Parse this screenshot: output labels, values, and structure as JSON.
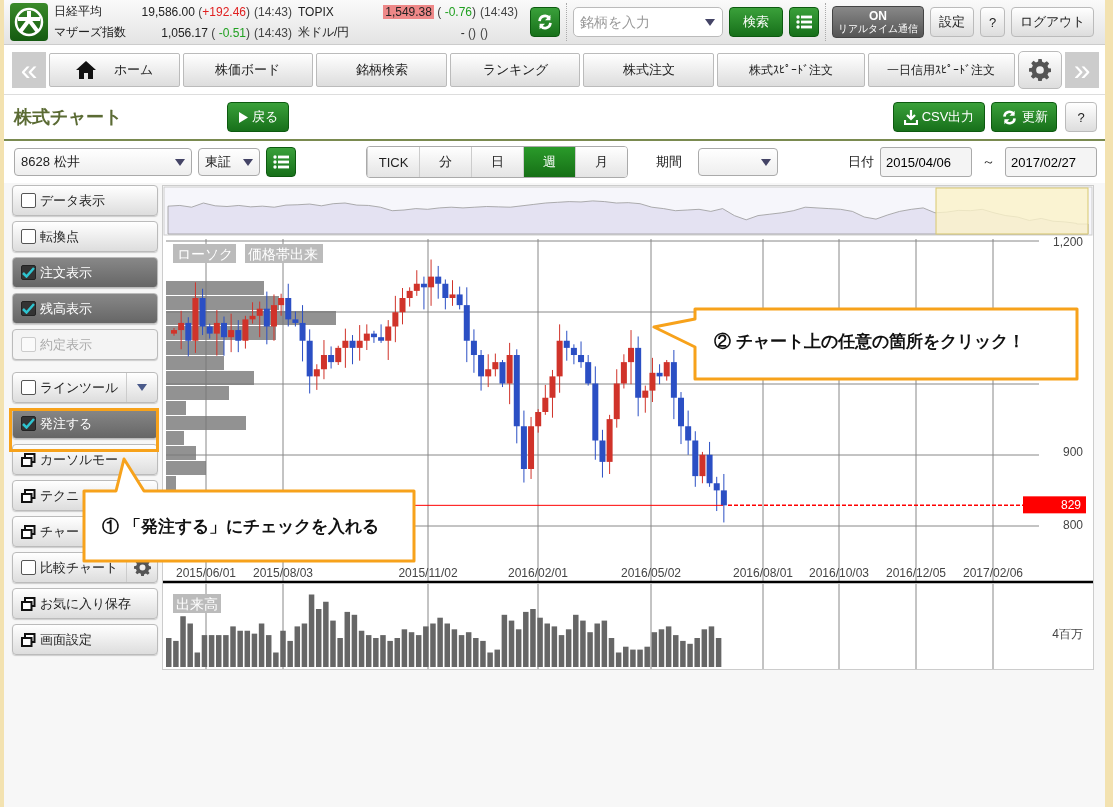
{
  "header": {
    "indices": [
      {
        "name": "日経平均",
        "value": "19,586.00",
        "change": "(+192.46)",
        "color": "#e02020",
        "time": "(14:43)",
        "highlighted": false
      },
      {
        "name": "マザーズ指数",
        "value": "1,056.17",
        "change": "( -0.51)",
        "color": "#20a020",
        "time": "(14:43)",
        "highlighted": false
      },
      {
        "name": "TOPIX",
        "value": "1,549.38",
        "change": "( -0.76)",
        "color": "#20a020",
        "time": "(14:43)",
        "highlighted": true
      },
      {
        "name": "米ドル/円",
        "value": "-",
        "change": "()",
        "color": "#444444",
        "time": "()",
        "highlighted": false
      }
    ],
    "search": {
      "placeholder": "銘柄を入力"
    },
    "search_button": "検索",
    "realtime": {
      "state": "ON",
      "label": "リアルタイム通信",
      "on": true
    },
    "buttons": [
      "設定",
      "?",
      "ログアウト"
    ]
  },
  "nav": {
    "tabs": [
      {
        "label": "ホーム"
      },
      {
        "label": "株価ボード"
      },
      {
        "label": "銘柄検索"
      },
      {
        "label": "ランキング"
      },
      {
        "label": "株式注文"
      },
      {
        "label": "株式ｽﾋﾟｰﾄﾞ注文"
      },
      {
        "label": "一日信用ｽﾋﾟｰﾄﾞ注文"
      }
    ],
    "prev": "«",
    "next": "»"
  },
  "page": {
    "title": "株式チャート",
    "back_button": "戻る",
    "csv_button": "CSV出力",
    "refresh_button": "更新",
    "help_button": "?"
  },
  "controls": {
    "symbol": "8628 松井",
    "market": "東証",
    "intervals": [
      {
        "label": "TICK",
        "selected": false
      },
      {
        "label": "分",
        "selected": false
      },
      {
        "label": "日",
        "selected": false
      },
      {
        "label": "週",
        "selected": true
      },
      {
        "label": "月",
        "selected": false
      }
    ],
    "period_label": "期間",
    "date_label": "日付",
    "date_from": "2015/04/06",
    "separator": "～",
    "date_to": "2017/02/27"
  },
  "sidebar": {
    "groups": [
      [
        {
          "kind": "checkbox",
          "label": "データ表示",
          "checked": false,
          "disabled": false
        },
        {
          "kind": "checkbox",
          "label": "転換点",
          "checked": false,
          "disabled": false
        },
        {
          "kind": "checkbox",
          "label": "注文表示",
          "checked": true,
          "disabled": false
        },
        {
          "kind": "checkbox",
          "label": "残高表示",
          "checked": true,
          "disabled": false
        },
        {
          "kind": "checkbox",
          "label": "約定表示",
          "checked": false,
          "disabled": true
        }
      ],
      [
        {
          "kind": "checkbox-dropdown",
          "label": "ラインツール",
          "checked": false,
          "disabled": false
        },
        {
          "kind": "checkbox",
          "label": "発注する",
          "checked": true,
          "disabled": false
        },
        {
          "kind": "window",
          "label": "カーソルモー"
        },
        {
          "kind": "window",
          "label": "テクニ"
        },
        {
          "kind": "window",
          "label": "チャー"
        },
        {
          "kind": "checkbox-gear",
          "label": "比較チャート",
          "checked": false,
          "disabled": false
        },
        {
          "kind": "window",
          "label": "お気に入り保存"
        },
        {
          "kind": "window",
          "label": "画面設定"
        }
      ]
    ]
  },
  "chart": {
    "candle_label": "ローソク",
    "profile_label": "価格帯出来",
    "volume_label": "出来高",
    "y_labels": [
      "1,200",
      "900",
      "800"
    ],
    "x_labels": [
      "2015/06/01",
      "2015/08/03",
      "2015/11/02",
      "2016/02/01",
      "2016/05/02",
      "2016/08/01",
      "2016/10/03",
      "2016/12/05",
      "2017/02/06"
    ],
    "last_price": "829",
    "volume_tick": "4百万"
  },
  "annotations": [
    {
      "text": "① 「発注する」にチェックを入れる"
    },
    {
      "text": "② チャート上の任意の箇所をクリック！"
    }
  ]
}
